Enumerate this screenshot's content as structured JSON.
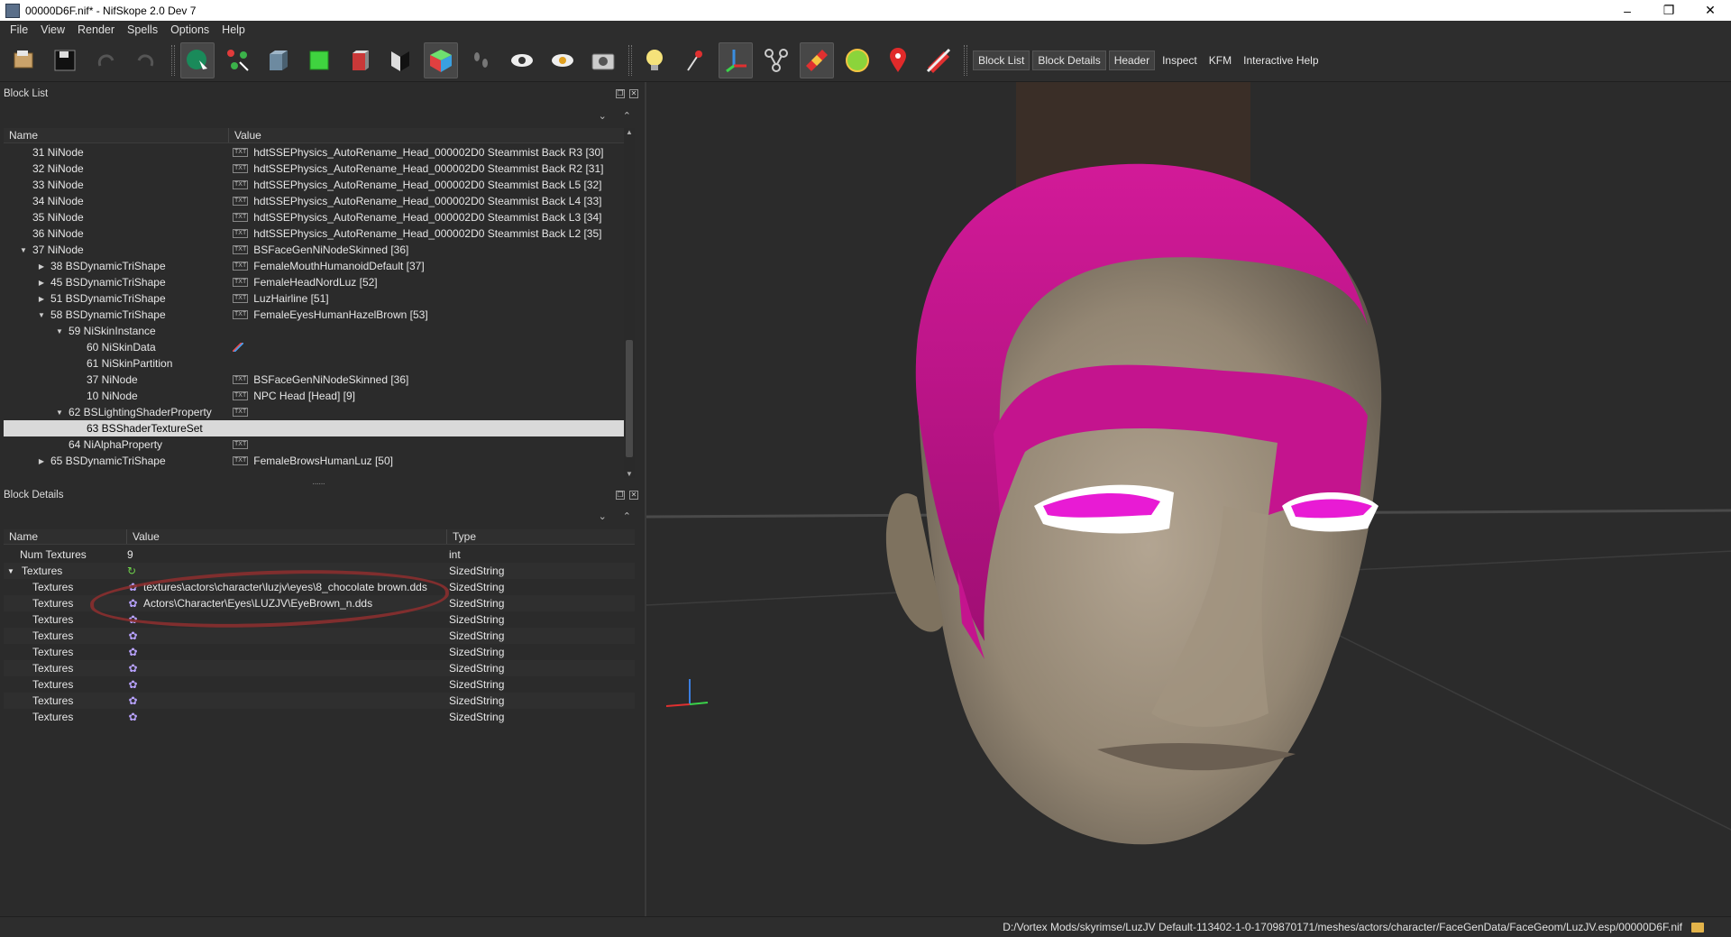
{
  "window": {
    "title": "00000D6F.nif* - NifSkope 2.0 Dev 7",
    "min": "–",
    "max": "❐",
    "close": "✕"
  },
  "menu": [
    "File",
    "View",
    "Render",
    "Spells",
    "Options",
    "Help"
  ],
  "toolbar": {
    "icons": [
      "load-icon",
      "save-icon",
      "undo-icon",
      "redo-icon",
      "select-object-icon",
      "select-vertex-icon",
      "view-front-icon",
      "view-top-icon",
      "view-side-icon",
      "view-user-icon",
      "view-perspective-icon",
      "walk-icon",
      "show-hidden-icon",
      "show-nodes-icon",
      "screenshot-icon",
      "lighting-icon",
      "pin-icon",
      "axes-icon",
      "constraints-icon",
      "textures-icon",
      "colors-icon",
      "marker-icon",
      "hidden-shapes-icon"
    ],
    "tabs": [
      "Block List",
      "Block Details",
      "Header",
      "Inspect",
      "KFM",
      "Interactive Help"
    ]
  },
  "blocklist": {
    "title": "Block List",
    "columns": [
      "Name",
      "Value"
    ],
    "rows": [
      {
        "name": "31 NiNode",
        "value": "hdtSSEPhysics_AutoRename_Head_000002D0 Steammist Back R3 [30]",
        "indent": 1,
        "arrow": "",
        "icon": "txt"
      },
      {
        "name": "32 NiNode",
        "value": "hdtSSEPhysics_AutoRename_Head_000002D0 Steammist Back R2 [31]",
        "indent": 1,
        "arrow": "",
        "icon": "txt"
      },
      {
        "name": "33 NiNode",
        "value": "hdtSSEPhysics_AutoRename_Head_000002D0 Steammist Back L5 [32]",
        "indent": 1,
        "arrow": "",
        "icon": "txt"
      },
      {
        "name": "34 NiNode",
        "value": "hdtSSEPhysics_AutoRename_Head_000002D0 Steammist Back L4 [33]",
        "indent": 1,
        "arrow": "",
        "icon": "txt"
      },
      {
        "name": "35 NiNode",
        "value": "hdtSSEPhysics_AutoRename_Head_000002D0 Steammist Back L3 [34]",
        "indent": 1,
        "arrow": "",
        "icon": "txt"
      },
      {
        "name": "36 NiNode",
        "value": "hdtSSEPhysics_AutoRename_Head_000002D0 Steammist Back L2 [35]",
        "indent": 1,
        "arrow": "",
        "icon": "txt"
      },
      {
        "name": "37 NiNode",
        "value": "BSFaceGenNiNodeSkinned [36]",
        "indent": 1,
        "arrow": "▼",
        "icon": "txt"
      },
      {
        "name": "38 BSDynamicTriShape",
        "value": "FemaleMouthHumanoidDefault [37]",
        "indent": 2,
        "arrow": "▶",
        "icon": "txt"
      },
      {
        "name": "45 BSDynamicTriShape",
        "value": "FemaleHeadNordLuz [52]",
        "indent": 2,
        "arrow": "▶",
        "icon": "txt"
      },
      {
        "name": "51 BSDynamicTriShape",
        "value": "LuzHairline [51]",
        "indent": 2,
        "arrow": "▶",
        "icon": "txt"
      },
      {
        "name": "58 BSDynamicTriShape",
        "value": "FemaleEyesHumanHazelBrown [53]",
        "indent": 2,
        "arrow": "▼",
        "icon": "txt"
      },
      {
        "name": "59 NiSkinInstance",
        "value": "",
        "indent": 3,
        "arrow": "▼",
        "icon": ""
      },
      {
        "name": "60 NiSkinData",
        "value": "",
        "indent": 4,
        "arrow": "",
        "icon": "line"
      },
      {
        "name": "61 NiSkinPartition",
        "value": "",
        "indent": 4,
        "arrow": "",
        "icon": ""
      },
      {
        "name": "37 NiNode",
        "value": "BSFaceGenNiNodeSkinned [36]",
        "indent": 4,
        "arrow": "",
        "icon": "txt"
      },
      {
        "name": "10 NiNode",
        "value": "NPC Head [Head] [9]",
        "indent": 4,
        "arrow": "",
        "icon": "txt"
      },
      {
        "name": "62 BSLightingShaderProperty",
        "value": "",
        "indent": 3,
        "arrow": "▼",
        "icon": "txt"
      },
      {
        "name": "63 BSShaderTextureSet",
        "value": "",
        "indent": 4,
        "arrow": "",
        "icon": "",
        "selected": true
      },
      {
        "name": "64 NiAlphaProperty",
        "value": "",
        "indent": 3,
        "arrow": "",
        "icon": "txt"
      },
      {
        "name": "65 BSDynamicTriShape",
        "value": "FemaleBrowsHumanLuz [50]",
        "indent": 2,
        "arrow": "▶",
        "icon": "txt"
      }
    ]
  },
  "details": {
    "title": "Block Details",
    "columns": [
      "Name",
      "Value",
      "Type"
    ],
    "rows": [
      {
        "name": "Num Textures",
        "value": "9",
        "type": "int",
        "indent": 1,
        "arrow": "",
        "icon": ""
      },
      {
        "name": "Textures",
        "value": "",
        "type": "SizedString",
        "indent": 0,
        "arrow": "▼",
        "icon": "cycle"
      },
      {
        "name": "Textures",
        "value": "textures\\actors\\character\\luzjv\\eyes\\8_chocolate brown.dds",
        "type": "SizedString",
        "indent": 2,
        "arrow": "",
        "icon": "flower"
      },
      {
        "name": "Textures",
        "value": "Actors\\Character\\Eyes\\LUZJV\\EyeBrown_n.dds",
        "type": "SizedString",
        "indent": 2,
        "arrow": "",
        "icon": "flower"
      },
      {
        "name": "Textures",
        "value": "",
        "type": "SizedString",
        "indent": 2,
        "arrow": "",
        "icon": "flower"
      },
      {
        "name": "Textures",
        "value": "",
        "type": "SizedString",
        "indent": 2,
        "arrow": "",
        "icon": "flower"
      },
      {
        "name": "Textures",
        "value": "",
        "type": "SizedString",
        "indent": 2,
        "arrow": "",
        "icon": "flower"
      },
      {
        "name": "Textures",
        "value": "",
        "type": "SizedString",
        "indent": 2,
        "arrow": "",
        "icon": "flower"
      },
      {
        "name": "Textures",
        "value": "",
        "type": "SizedString",
        "indent": 2,
        "arrow": "",
        "icon": "flower"
      },
      {
        "name": "Textures",
        "value": "",
        "type": "SizedString",
        "indent": 2,
        "arrow": "",
        "icon": "flower"
      },
      {
        "name": "Textures",
        "value": "",
        "type": "SizedString",
        "indent": 2,
        "arrow": "",
        "icon": "flower"
      }
    ]
  },
  "status": {
    "path": "D:/Vortex Mods/skyrimse/LuzJV Default-113402-1-0-1709870171/meshes/actors/character/FaceGenData/FaceGeom/LuzJV.esp/00000D6F.nif"
  },
  "colors": {
    "magenta": "#c4148e",
    "skin": "#a89a86",
    "bg": "#2b2b2b",
    "annotation": "#8a2f2f"
  }
}
